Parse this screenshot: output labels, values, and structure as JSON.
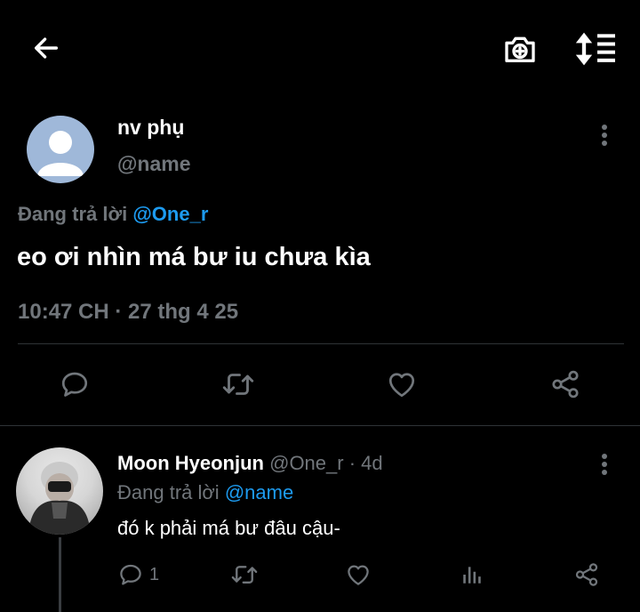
{
  "colors": {
    "background": "#000000",
    "text": "#e7e9ea",
    "muted": "#71767b",
    "link": "#1d9bf0",
    "divider": "#2f3336"
  },
  "topbar": {
    "back_icon": "arrow-left-icon",
    "camera_icon": "camera-add-icon",
    "sort_icon": "sort-list-icon"
  },
  "tweet": {
    "display_name": "nv phụ",
    "handle": "@name",
    "replying_prefix": "Đang trả lời",
    "replying_to": "@One_r",
    "text": "eo ơi nhìn má bư iu chưa kìa",
    "timestamp": "10:47 CH · 27 thg 4 25",
    "actions": [
      "reply-icon",
      "retweet-icon",
      "like-icon",
      "share-icon"
    ]
  },
  "reply": {
    "display_name": "Moon Hyeonjun",
    "handle": "@One_r",
    "time": "· 4d",
    "replying_prefix": "Đang trả lời",
    "replying_to": "@name",
    "text": "đó k phải má bư đâu cậu-",
    "reply_count": "1",
    "actions": [
      "reply-icon",
      "retweet-icon",
      "like-icon",
      "views-icon",
      "share-icon"
    ]
  }
}
